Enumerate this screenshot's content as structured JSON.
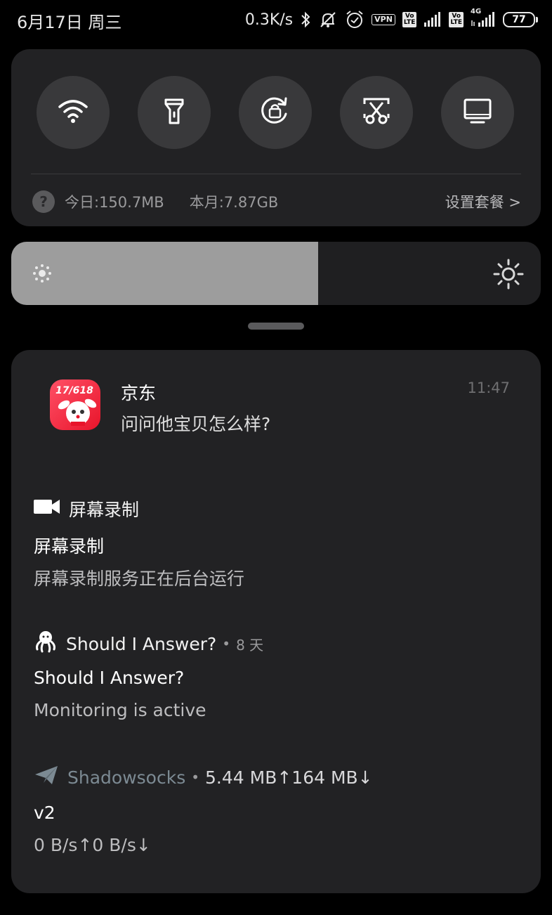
{
  "status_bar": {
    "datetime": "6月17日 周三",
    "net_speed": "0.3K/s",
    "vpn_label": "VPN",
    "volte_label": "Vo LTE",
    "network_type": "4G",
    "battery_level": "77",
    "icons": [
      "bluetooth-icon",
      "alarm-mute-icon",
      "alarm-icon",
      "vpn-icon",
      "volte-icon",
      "signal-icon",
      "volte-icon",
      "signal-4g-icon",
      "battery-icon"
    ]
  },
  "quick_settings": {
    "toggles": [
      {
        "name": "wifi",
        "icon": "wifi-icon"
      },
      {
        "name": "flashlight",
        "icon": "flashlight-icon"
      },
      {
        "name": "rotation-lock",
        "icon": "rotation-lock-icon"
      },
      {
        "name": "screenshot",
        "icon": "scissors-icon"
      },
      {
        "name": "cast",
        "icon": "screen-icon"
      }
    ],
    "data_today": "今日:150.7MB",
    "data_month": "本月:7.87GB",
    "plan_link": "设置套餐 >"
  },
  "brightness": {
    "level": 0.58
  },
  "notifications": {
    "jd": {
      "icon_label": "17/618",
      "app": "京东",
      "message": "问问他宝贝怎么样?",
      "time": "11:47"
    },
    "screen_record": {
      "app": "屏幕录制",
      "title": "屏幕录制",
      "body": "屏幕录制服务正在后台运行"
    },
    "should_answer": {
      "app": "Should I Answer?",
      "separator": "•",
      "meta": "8 天",
      "title": "Should I Answer?",
      "body": "Monitoring is active"
    },
    "shadowsocks": {
      "app": "Shadowsocks",
      "separator": "•",
      "meta": "5.44 MB↑164 MB↓",
      "title": "v2",
      "body": "0 B/s↑0 B/s↓"
    }
  },
  "colors": {
    "panel": "#222224",
    "toggle": "#39393b",
    "brightness_fill": "#9d9d9d",
    "jd_red": "#e8142a"
  }
}
